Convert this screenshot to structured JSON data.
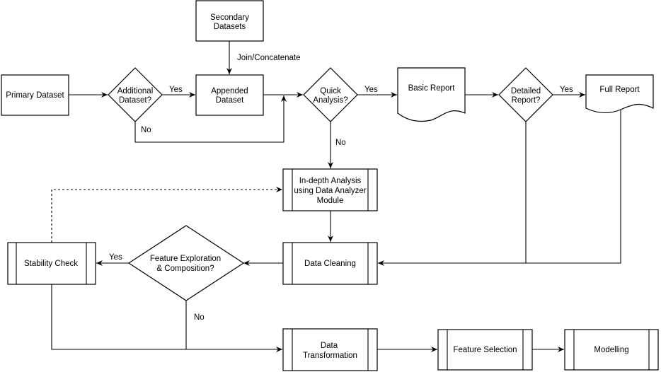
{
  "nodes": {
    "primary": {
      "lines": [
        "Primary Dataset"
      ]
    },
    "additional": {
      "lines": [
        "Additional",
        "Dataset?"
      ]
    },
    "secondary": {
      "lines": [
        "Secondary",
        "Datasets"
      ]
    },
    "appended": {
      "lines": [
        "Appended",
        "Dataset"
      ]
    },
    "quick": {
      "lines": [
        "Quick",
        "Analysis?"
      ]
    },
    "basic_report": {
      "lines": [
        "Basic Report"
      ]
    },
    "detailed": {
      "lines": [
        "Detailed",
        "Report?"
      ]
    },
    "full_report": {
      "lines": [
        "Full Report"
      ]
    },
    "indepth": {
      "lines": [
        "In-depth Analysis",
        "using Data Analyzer",
        "Module"
      ]
    },
    "cleaning": {
      "lines": [
        "Data Cleaning"
      ]
    },
    "feature_q": {
      "lines": [
        "Feature Exploration",
        "& Composition?"
      ]
    },
    "stability": {
      "lines": [
        "Stability Check"
      ]
    },
    "transformation": {
      "lines": [
        "Data",
        "Transformation"
      ]
    },
    "selection": {
      "lines": [
        "Feature Selection"
      ]
    },
    "modelling": {
      "lines": [
        "Modelling"
      ]
    }
  },
  "edge_labels": {
    "join": "Join/Concatenate",
    "additional_yes": "Yes",
    "additional_no": "No",
    "quick_yes": "Yes",
    "quick_no": "No",
    "detailed_yes": "Yes",
    "feature_yes": "Yes",
    "feature_no": "No"
  }
}
